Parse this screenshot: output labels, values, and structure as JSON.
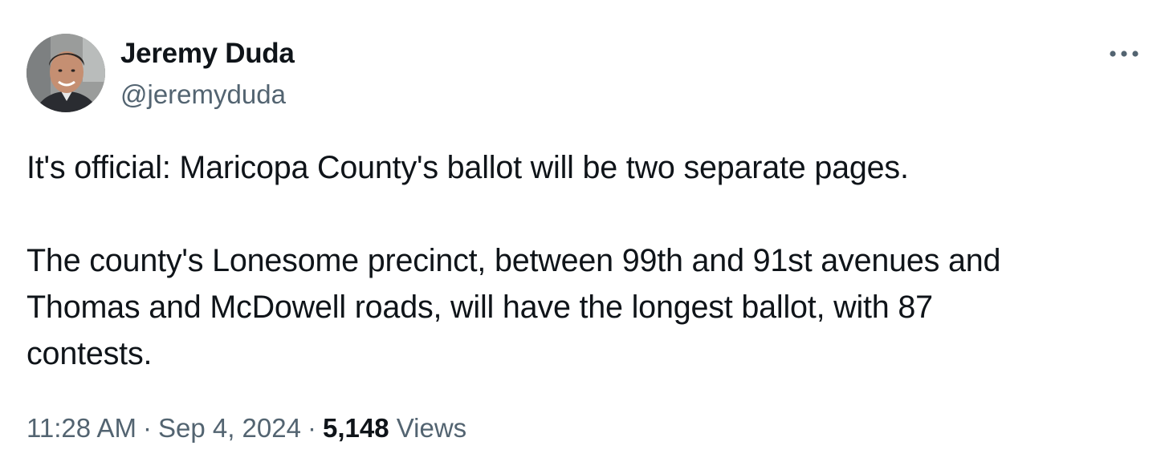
{
  "author": {
    "display_name": "Jeremy Duda",
    "handle": "@jeremyduda",
    "avatar_icon": "profile-photo"
  },
  "menu": {
    "more_icon": "more-horizontal-icon"
  },
  "tweet": {
    "paragraphs": [
      "It's official: Maricopa County's ballot will be two separate pages.",
      "The county's Lonesome precinct, between 99th and 91st avenues and\nThomas and McDowell roads, will have the longest ballot, with 87\ncontests."
    ]
  },
  "meta": {
    "time": "11:28 AM",
    "date": "Sep 4, 2024",
    "separator": "·",
    "views_count": "5,148",
    "views_label": "Views"
  },
  "colors": {
    "primary_text": "#0f1419",
    "secondary_text": "#536471",
    "background": "#ffffff"
  }
}
